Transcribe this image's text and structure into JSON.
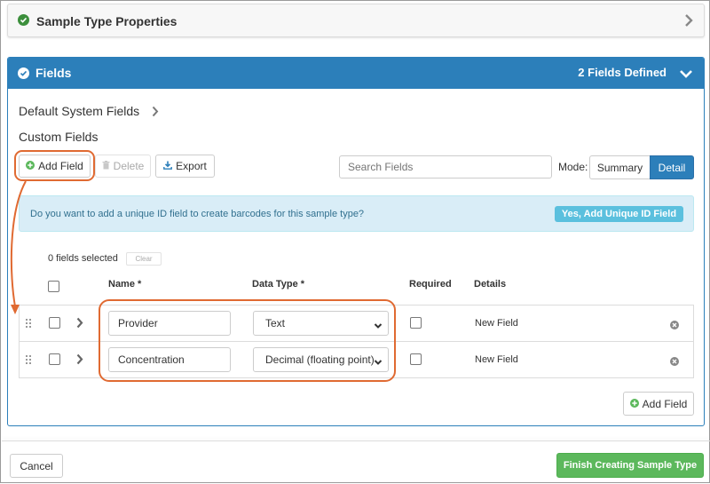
{
  "props_panel": {
    "title": "Sample Type Properties"
  },
  "fields_panel": {
    "title": "Fields",
    "count_label": "2 Fields Defined",
    "system_fields_label": "Default System Fields",
    "custom_fields_label": "Custom Fields"
  },
  "toolbar": {
    "add_field": "Add Field",
    "delete": "Delete",
    "export": "Export",
    "search_placeholder": "Search Fields",
    "mode_label": "Mode:",
    "mode_summary": "Summary",
    "mode_detail": "Detail",
    "mode_selected": "Detail"
  },
  "info_bar": {
    "message": "Do you want to add a unique ID field to create barcodes for this sample type?",
    "button": "Yes, Add Unique ID Field"
  },
  "selection": {
    "label": "0 fields selected",
    "clear": "Clear"
  },
  "table": {
    "headers": {
      "name": "Name *",
      "data_type": "Data Type *",
      "required": "Required",
      "details": "Details"
    },
    "rows": [
      {
        "name": "Provider",
        "data_type": "Text",
        "required": false,
        "details": "New Field"
      },
      {
        "name": "Concentration",
        "data_type": "Decimal (floating point)",
        "required": false,
        "details": "New Field"
      }
    ]
  },
  "add_field_bottom": "Add Field",
  "footer": {
    "cancel": "Cancel",
    "finish": "Finish Creating Sample Type"
  },
  "colors": {
    "primary": "#2c7fba",
    "success": "#5cb85c",
    "info_bg": "#d9edf7",
    "info_button": "#5bc0de",
    "annotation": "#e06a32"
  }
}
